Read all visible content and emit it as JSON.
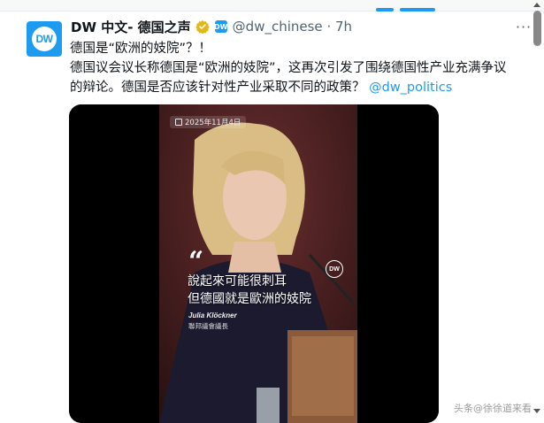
{
  "tweet": {
    "display_name": "DW 中文- 德国之声",
    "handle": "@dw_chinese",
    "separator": "·",
    "time": "7h",
    "avatar_text": "DW",
    "affiliation_badge_text": "DW",
    "text_line1": "德国是“欧洲的妓院”？！",
    "text_line2": "德国议会议长称德国是“欧洲的妓院”，这再次引发了围绕德国性产业充满争议",
    "text_line3": "的辩论。德国是否应该针对性产业采取不同的政策？",
    "mention": "@dw_politics",
    "more_label": "···"
  },
  "media": {
    "date_badge": "2025年11月4日",
    "watermark": "DW",
    "quote_mark": "“",
    "caption_line1": "說起來可能很刺耳",
    "caption_line2": "但德國就是歐洲的妓院",
    "speaker_name": "Julia Klöckner",
    "speaker_title": "聯邦議會議長"
  },
  "overlay": {
    "text": "头条@徐徐道来看"
  },
  "colors": {
    "link": "#1d9bf0",
    "secondary_text": "#536471",
    "verified_gold": "#e2b719"
  },
  "icons": {
    "verified": "verified-gold-badge",
    "affiliation": "affiliate-badge",
    "more": "more-icon",
    "calendar": "calendar-icon"
  }
}
